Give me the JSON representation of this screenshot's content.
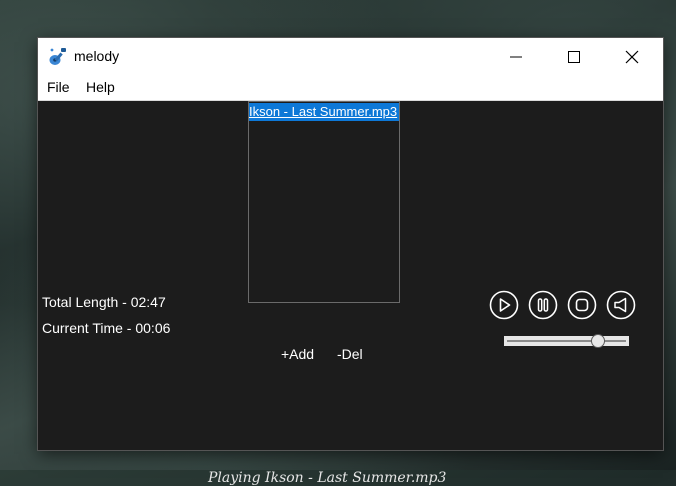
{
  "window": {
    "title": "melody",
    "app_icon": "guitar-icon"
  },
  "menu": {
    "file": "File",
    "help": "Help"
  },
  "info": {
    "total_length": "Total Length - 02:47",
    "current_time": "Current Time - 00:06"
  },
  "playlist": {
    "items": [
      "Ikson - Last Summer.mp3"
    ],
    "selected_index": 0,
    "add_label": "+Add",
    "del_label": "-Del"
  },
  "controls": {
    "play": "play-icon",
    "pause": "pause-icon",
    "stop": "stop-icon",
    "mute": "speaker-icon",
    "volume_fraction": 0.8
  },
  "status": {
    "text": "Playing  Ikson - Last Summer.mp3"
  },
  "colors": {
    "background": "#1c1c1c",
    "selection": "#0d78d7",
    "text": "#ffffff"
  }
}
